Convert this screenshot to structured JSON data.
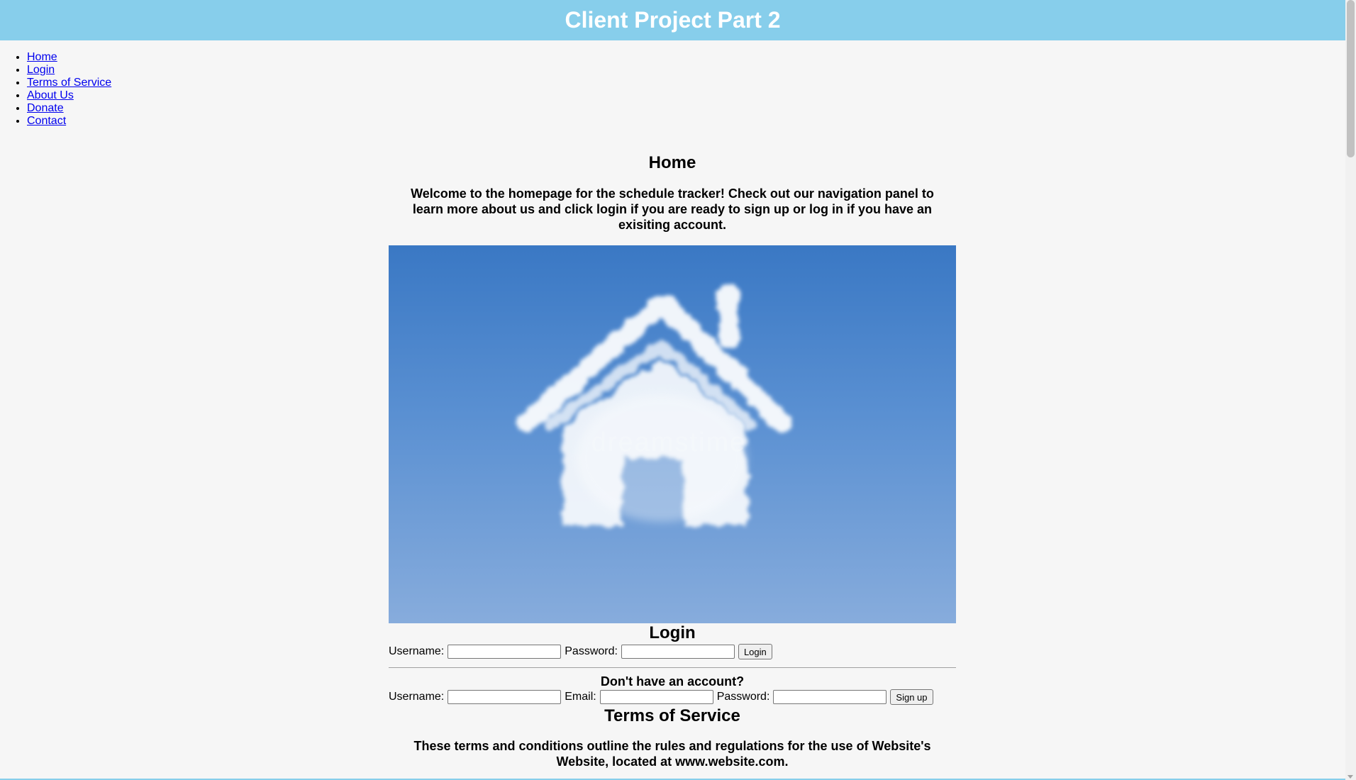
{
  "header": {
    "title": "Client Project Part 2"
  },
  "nav": {
    "items": [
      {
        "label": "Home"
      },
      {
        "label": "Login"
      },
      {
        "label": "Terms of Service"
      },
      {
        "label": "About Us"
      },
      {
        "label": "Donate"
      },
      {
        "label": "Contact"
      }
    ]
  },
  "home": {
    "title": "Home",
    "intro": "Welcome to the homepage for the schedule tracker! Check out our navigation panel to learn more about us and click login if you are ready to sign up or log in if you have an exisiting account.",
    "image_watermark": "dreamstime"
  },
  "login": {
    "title": "Login",
    "username_label": "Username:",
    "password_label": "Password:",
    "button": "Login"
  },
  "signup": {
    "title": "Don't have an account?",
    "username_label": "Username:",
    "email_label": "Email:",
    "password_label": "Password:",
    "button": "Sign up"
  },
  "terms": {
    "title": "Terms of Service",
    "text": "These terms and conditions outline the rules and regulations for the use of Website's Website, located at www.website.com."
  },
  "colors": {
    "header_bg": "#87ceeb",
    "page_bg": "#f6f6f6",
    "link": "#0000ee"
  }
}
